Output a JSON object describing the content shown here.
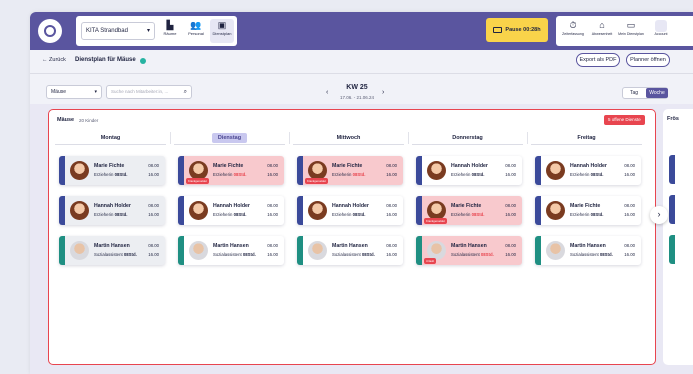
{
  "header": {
    "site_select": "KITA Strandbad",
    "nav": [
      {
        "label": "Räume",
        "icon": "building-icon"
      },
      {
        "label": "Personal",
        "icon": "people-icon"
      },
      {
        "label": "Dienstplan",
        "icon": "calendar-person-icon"
      }
    ],
    "pause_label": "Pause  00:28h",
    "right_nav": [
      {
        "label": "Zeiterfassung",
        "icon": "stopwatch-icon"
      },
      {
        "label": "Abwesenheit",
        "icon": "home-icon"
      },
      {
        "label": "Mein Dienstplan",
        "icon": "calendar-icon"
      },
      {
        "label": "Account",
        "icon": "avatar"
      }
    ]
  },
  "subheader": {
    "back": "← Zurück",
    "title": "Dienstplan für Mäuse",
    "export": "Export als PDF",
    "planner": "Planner öffnen"
  },
  "filters": {
    "group": "Mäuse",
    "search_placeholder": "Suche nach Mitarbeiter:in, ...",
    "week": "KW 25",
    "range": "17.06. - 21.06.24",
    "view_day": "Tag",
    "view_week": "Woche"
  },
  "board": {
    "group_name": "Mäuse",
    "group_count": "20 Kinder",
    "open_badge": "5 offene Dienste",
    "next_group": "Frös",
    "days": [
      "Montag",
      "Dienstag",
      "Mittwoch",
      "Donnerstag",
      "Freitag"
    ],
    "today_index": 1
  },
  "colors": {
    "primary": "#5a559f",
    "alert": "#e8454f",
    "pause": "#f9d34a",
    "bar_blue": "#3b4a9a",
    "bar_teal": "#1f8f82"
  },
  "shifts": [
    [
      {
        "name": "Marie Fichte",
        "role": "Erzieherin",
        "hours": "08Std.",
        "start": "08.00",
        "end": "16.00",
        "bar": "blue",
        "state": "gray",
        "tag": "",
        "gender": "f"
      },
      {
        "name": "Hannah Holder",
        "role": "Erzieherin",
        "hours": "08Std.",
        "start": "08.00",
        "end": "16.00",
        "bar": "blue",
        "state": "gray",
        "tag": "",
        "gender": "f"
      },
      {
        "name": "Martin Hansen",
        "role": "Sozialassistent",
        "hours": "08Std.",
        "start": "08.00",
        "end": "16.00",
        "bar": "teal",
        "state": "gray",
        "tag": "",
        "gender": "m"
      }
    ],
    [
      {
        "name": "Marie Fichte",
        "role": "Erzieherin",
        "hours": "08Std.",
        "start": "08.00",
        "end": "16.00",
        "bar": "blue",
        "state": "red",
        "tag": "Krankgemeldet",
        "gender": "f"
      },
      {
        "name": "Hannah Holder",
        "role": "Erzieherin",
        "hours": "08Std.",
        "start": "08.00",
        "end": "16.00",
        "bar": "blue",
        "state": "white",
        "tag": "",
        "gender": "f"
      },
      {
        "name": "Martin Hansen",
        "role": "Sozialassistent",
        "hours": "08Std.",
        "start": "08.00",
        "end": "16.00",
        "bar": "teal",
        "state": "white",
        "tag": "",
        "gender": "m"
      }
    ],
    [
      {
        "name": "Marie Fichte",
        "role": "Erzieherin",
        "hours": "08Std.",
        "start": "08.00",
        "end": "16.00",
        "bar": "blue",
        "state": "red",
        "tag": "Krankgemeldet",
        "gender": "f"
      },
      {
        "name": "Hannah Holder",
        "role": "Erzieherin",
        "hours": "08Std.",
        "start": "08.00",
        "end": "16.00",
        "bar": "blue",
        "state": "white",
        "tag": "",
        "gender": "f"
      },
      {
        "name": "Martin Hansen",
        "role": "Sozialassistent",
        "hours": "08Std.",
        "start": "08.00",
        "end": "16.00",
        "bar": "teal",
        "state": "white",
        "tag": "",
        "gender": "m"
      }
    ],
    [
      {
        "name": "Hannah Holder",
        "role": "Erzieherin",
        "hours": "08Std.",
        "start": "08.00",
        "end": "16.00",
        "bar": "blue",
        "state": "white",
        "tag": "",
        "gender": "f"
      },
      {
        "name": "Marie Fichte",
        "role": "Erzieherin",
        "hours": "08Std.",
        "start": "08.00",
        "end": "16.00",
        "bar": "blue",
        "state": "red",
        "tag": "Krankgemeldet",
        "gender": "f"
      },
      {
        "name": "Martin Hansen",
        "role": "Sozialassistent",
        "hours": "08Std.",
        "start": "08.00",
        "end": "16.00",
        "bar": "teal",
        "state": "red",
        "tag": "Urlaub",
        "gender": "m"
      }
    ],
    [
      {
        "name": "Hannah Holder",
        "role": "Erzieherin",
        "hours": "08Std.",
        "start": "08.00",
        "end": "16.00",
        "bar": "blue",
        "state": "white",
        "tag": "",
        "gender": "f"
      },
      {
        "name": "Marie Fichte",
        "role": "Erzieherin",
        "hours": "08Std.",
        "start": "08.00",
        "end": "16.00",
        "bar": "blue",
        "state": "white",
        "tag": "",
        "gender": "f"
      },
      {
        "name": "Martin Hansen",
        "role": "Sozialassistent",
        "hours": "08Std.",
        "start": "08.00",
        "end": "16.00",
        "bar": "teal",
        "state": "white",
        "tag": "",
        "gender": "m"
      }
    ]
  ],
  "pagination": {
    "pages": 6,
    "current": 0
  }
}
